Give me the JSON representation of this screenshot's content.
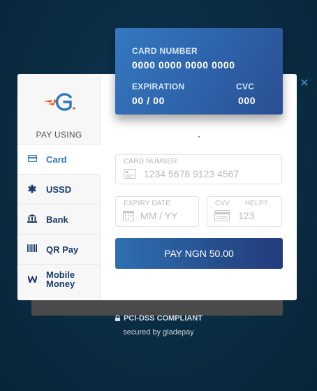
{
  "credit_card": {
    "number_label": "CARD NUMBER",
    "number_value": "0000 0000 0000 0000",
    "expiration_label": "EXPIRATION",
    "expiration_value": "00 / 00",
    "cvc_label": "CVC",
    "cvc_value": "000"
  },
  "sidebar": {
    "pay_using": "PAY USING",
    "items": [
      {
        "label": "Card",
        "icon": "card-icon"
      },
      {
        "label": "USSD",
        "icon": "asterisk-icon"
      },
      {
        "label": "Bank",
        "icon": "bank-icon"
      },
      {
        "label": "QR Pay",
        "icon": "barcode-icon"
      },
      {
        "label_line1": "Mobile",
        "label_line2": "Money",
        "icon": "wallet-icon"
      }
    ]
  },
  "form": {
    "card_number_label": "CARD NUMBER",
    "card_number_placeholder": "1234 5678 9123 4567",
    "expiry_label": "EXPIRY DATE",
    "expiry_placeholder": "MM / YY",
    "cvv_label": "CVV",
    "cvv_help": "HELP?",
    "cvv_placeholder": "123",
    "pay_button": "PAY NGN 50.00"
  },
  "footer": {
    "compliance": "PCI-DSS COMPLIANT",
    "secured_by": "secured by gladepay"
  },
  "colors": {
    "accent": "#2d79bd",
    "brand_navy": "#1b3c6b",
    "logo_orange": "#f05a28",
    "background": "#0b2e45"
  }
}
